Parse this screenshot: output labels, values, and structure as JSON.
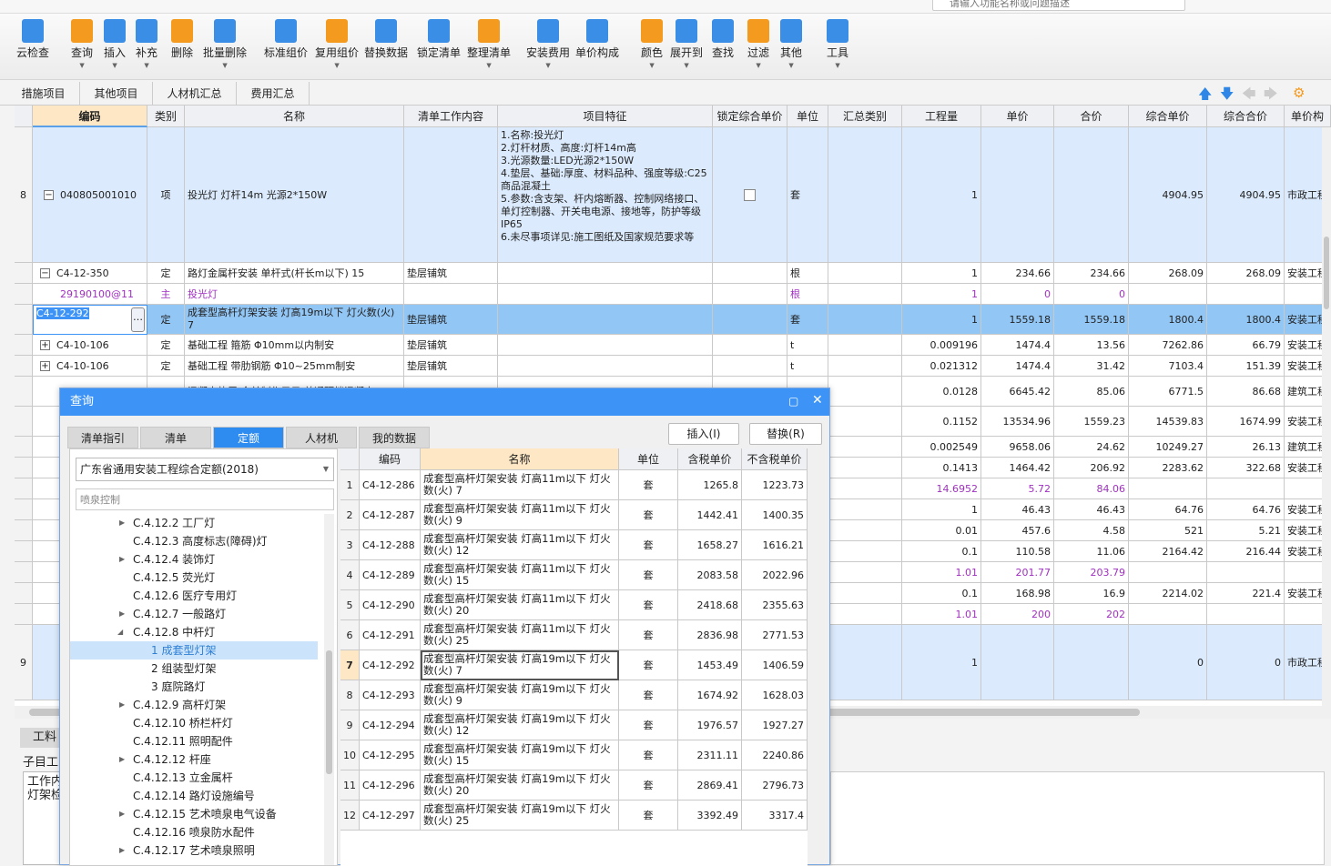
{
  "search_placeholder": "请输入功能名称或问题描述",
  "toolbar": [
    {
      "label": "云检查",
      "icon": "cloud-check-icon",
      "dd": false
    },
    {
      "label": "查询",
      "icon": "query-icon",
      "dd": true
    },
    {
      "label": "插入",
      "icon": "insert-icon",
      "dd": true
    },
    {
      "label": "补充",
      "icon": "supplement-icon",
      "dd": true
    },
    {
      "label": "删除",
      "icon": "delete-icon",
      "dd": false
    },
    {
      "label": "批量删除",
      "icon": "batch-delete-icon",
      "dd": true
    },
    {
      "label": "标准组价",
      "icon": "standard-pricing-icon",
      "dd": false
    },
    {
      "label": "复用组价",
      "icon": "reuse-pricing-icon",
      "dd": true
    },
    {
      "label": "替换数据",
      "icon": "replace-data-icon",
      "dd": false
    },
    {
      "label": "锁定清单",
      "icon": "lock-list-icon",
      "dd": false
    },
    {
      "label": "整理清单",
      "icon": "organize-list-icon",
      "dd": true
    },
    {
      "label": "安装费用",
      "icon": "install-cost-icon",
      "dd": true
    },
    {
      "label": "单价构成",
      "icon": "unit-price-icon",
      "dd": false
    },
    {
      "label": "颜色",
      "icon": "color-icon",
      "dd": true
    },
    {
      "label": "展开到",
      "icon": "expand-icon",
      "dd": true
    },
    {
      "label": "查找",
      "icon": "find-icon",
      "dd": false
    },
    {
      "label": "过滤",
      "icon": "filter-icon",
      "dd": true
    },
    {
      "label": "其他",
      "icon": "other-icon",
      "dd": true
    },
    {
      "label": "工具",
      "icon": "tools-icon",
      "dd": true
    }
  ],
  "page_tabs": [
    "措施项目",
    "其他项目",
    "人材机汇总",
    "费用汇总"
  ],
  "grid": {
    "columns": [
      "",
      "编码",
      "类别",
      "名称",
      "清单工作内容",
      "项目特征",
      "锁定综合单价",
      "单位",
      "汇总类别",
      "工程量",
      "单价",
      "合价",
      "综合单价",
      "综合合价",
      "单价构"
    ],
    "rows": [
      {
        "n": "8",
        "code": "040805001010",
        "type": "项",
        "name": "投光灯 灯杆14m 光源2*150W",
        "work": "",
        "feature": "1.名称:投光灯\n2.灯杆材质、高度:灯杆14m高\n3.光源数量:LED光源2*150W\n4.垫层、基础:厚度、材料品种、强度等级:C25商品混凝土\n5.参数:含支架、杆内熔断器、控制网络接口、单灯控制器、开关电电源、接地等，防护等级IP65\n6.未尽事项详见:施工图纸及国家规范要求等",
        "unit": "套",
        "qty": "1",
        "price": "",
        "total": "",
        "cprice": "4904.95",
        "ctotal": "4904.95",
        "comp": "市政工程"
      },
      {
        "n": "",
        "code": "C4-12-350",
        "type": "定",
        "name": "路灯金属杆安装 单杆式(杆长m以下) 15",
        "work": "垫层铺筑",
        "unit": "根",
        "qty": "1",
        "price": "234.66",
        "total": "234.66",
        "cprice": "268.09",
        "ctotal": "268.09",
        "comp": "安装工程"
      },
      {
        "n": "",
        "code": "29190100@11",
        "type": "主",
        "name": "投光灯",
        "work": "",
        "unit": "根",
        "qty": "1",
        "price": "0",
        "total": "0",
        "cprice": "",
        "ctotal": "",
        "comp": "",
        "purple": true
      },
      {
        "n": "",
        "code": "C4-12-292",
        "type": "定",
        "name": "成套型高杆灯架安装 灯高19m以下 灯火数(火) 7",
        "work": "垫层铺筑",
        "unit": "套",
        "qty": "1",
        "price": "1559.18",
        "total": "1559.18",
        "cprice": "1800.4",
        "ctotal": "1800.4",
        "comp": "安装工程",
        "sel": true
      },
      {
        "n": "",
        "code": "C4-10-106",
        "type": "定",
        "name": "基础工程 箍筋 Φ10mm以内制安",
        "work": "垫层铺筑",
        "unit": "t",
        "qty": "0.009196",
        "price": "1474.4",
        "total": "13.56",
        "cprice": "7262.86",
        "ctotal": "66.79",
        "comp": "安装工程"
      },
      {
        "n": "",
        "code": "C4-10-106",
        "type": "定",
        "name": "基础工程  带肋钢筋 Φ10~25mm制安",
        "work": "垫层铺筑",
        "unit": "t",
        "qty": "0.021312",
        "price": "1474.4",
        "total": "31.42",
        "cprice": "7103.4",
        "ctotal": "151.39",
        "comp": "安装工程"
      },
      {
        "n": "",
        "code": "",
        "type": "",
        "name": "混凝土垫层  含并制作子目 普通预拌混凝土",
        "work": "",
        "unit": "",
        "qty": "0.0128",
        "price": "6645.42",
        "total": "85.06",
        "cprice": "6771.5",
        "ctotal": "86.68",
        "comp": "建筑工程"
      },
      {
        "qty": "0.1152",
        "price": "13534.96",
        "total": "1559.23",
        "cprice": "14539.83",
        "ctotal": "1674.99",
        "comp": "安装工程"
      },
      {
        "qty": "0.002549",
        "price": "9658.06",
        "total": "24.62",
        "cprice": "10249.27",
        "ctotal": "26.13",
        "comp": "建筑工程"
      },
      {
        "qty": "0.1413",
        "price": "1464.42",
        "total": "206.92",
        "cprice": "2283.62",
        "ctotal": "322.68",
        "comp": "安装工程"
      },
      {
        "qty": "14.6952",
        "price": "5.72",
        "total": "84.06",
        "cprice": "",
        "ctotal": "",
        "comp": "",
        "purple": true
      },
      {
        "qty": "1",
        "price": "46.43",
        "total": "46.43",
        "cprice": "64.76",
        "ctotal": "64.76",
        "comp": "安装工程"
      },
      {
        "qty": "0.01",
        "price": "457.6",
        "total": "4.58",
        "cprice": "521",
        "ctotal": "5.21",
        "comp": "安装工程"
      },
      {
        "qty": "0.1",
        "price": "110.58",
        "total": "11.06",
        "cprice": "2164.42",
        "ctotal": "216.44",
        "comp": "安装工程"
      },
      {
        "qty": "1.01",
        "price": "201.77",
        "total": "203.79",
        "cprice": "",
        "ctotal": "",
        "comp": "",
        "purple": true
      },
      {
        "qty": "0.1",
        "price": "168.98",
        "total": "16.9",
        "cprice": "2214.02",
        "ctotal": "221.4",
        "comp": "安装工程"
      },
      {
        "qty": "1.01",
        "price": "200",
        "total": "202",
        "cprice": "",
        "ctotal": "",
        "comp": "",
        "purple": true
      },
      {
        "n": "9",
        "qty": "1",
        "price": "",
        "total": "",
        "cprice": "0",
        "ctotal": "0",
        "comp": "市政工程",
        "blue": true
      }
    ]
  },
  "bottom": {
    "tab": "工料",
    "label": "子目工",
    "text": "工作内\n灯架检"
  },
  "dialog": {
    "title": "查询",
    "tabs": [
      "清单指引",
      "清单",
      "定额",
      "人材机",
      "我的数据"
    ],
    "active_tab": "定额",
    "insert_label": "插入(I)",
    "replace_label": "替换(R)",
    "library": "广东省通用安装工程综合定额(2018)",
    "search_value": "喷泉控制",
    "tree": [
      {
        "t": "C.4.12.2 工厂灯",
        "lv": 1,
        "arrow": true
      },
      {
        "t": "C.4.12.3 高度标志(障碍)灯",
        "lv": 1
      },
      {
        "t": "C.4.12.4 装饰灯",
        "lv": 1,
        "arrow": true
      },
      {
        "t": "C.4.12.5 荧光灯",
        "lv": 1
      },
      {
        "t": "C.4.12.6 医疗专用灯",
        "lv": 1
      },
      {
        "t": "C.4.12.7 一般路灯",
        "lv": 1,
        "arrow": true
      },
      {
        "t": "C.4.12.8 中杆灯",
        "lv": 1,
        "arrow": true,
        "open": true
      },
      {
        "t": "1 成套型灯架",
        "lv": 2,
        "sel": true
      },
      {
        "t": "2 组装型灯架",
        "lv": 2
      },
      {
        "t": "3 庭院路灯",
        "lv": 2
      },
      {
        "t": "C.4.12.9 高杆灯架",
        "lv": 1,
        "arrow": true
      },
      {
        "t": "C.4.12.10 桥栏杆灯",
        "lv": 1
      },
      {
        "t": "C.4.12.11 照明配件",
        "lv": 1
      },
      {
        "t": "C.4.12.12 杆座",
        "lv": 1,
        "arrow": true
      },
      {
        "t": "C.4.12.13 立金属杆",
        "lv": 1
      },
      {
        "t": "C.4.12.14 路灯设施编号",
        "lv": 1
      },
      {
        "t": "C.4.12.15 艺术喷泉电气设备",
        "lv": 1,
        "arrow": true
      },
      {
        "t": "C.4.12.16 喷泉防水配件",
        "lv": 1
      },
      {
        "t": "C.4.12.17 艺术喷泉照明",
        "lv": 1,
        "arrow": true
      }
    ],
    "columns": [
      "",
      "编码",
      "名称",
      "单位",
      "含税单价",
      "不含税单价"
    ],
    "rows": [
      [
        "1",
        "C4-12-286",
        "成套型高杆灯架安装 灯高11m以下 灯火数(火) 7",
        "套",
        "1265.8",
        "1223.73"
      ],
      [
        "2",
        "C4-12-287",
        "成套型高杆灯架安装 灯高11m以下 灯火数(火) 9",
        "套",
        "1442.41",
        "1400.35"
      ],
      [
        "3",
        "C4-12-288",
        "成套型高杆灯架安装 灯高11m以下 灯火数(火) 12",
        "套",
        "1658.27",
        "1616.21"
      ],
      [
        "4",
        "C4-12-289",
        "成套型高杆灯架安装 灯高11m以下 灯火数(火) 15",
        "套",
        "2083.58",
        "2022.96"
      ],
      [
        "5",
        "C4-12-290",
        "成套型高杆灯架安装 灯高11m以下 灯火数(火) 20",
        "套",
        "2418.68",
        "2355.63"
      ],
      [
        "6",
        "C4-12-291",
        "成套型高杆灯架安装 灯高11m以下 灯火数(火) 25",
        "套",
        "2836.98",
        "2771.53"
      ],
      [
        "7",
        "C4-12-292",
        "成套型高杆灯架安装 灯高19m以下 灯火数(火) 7",
        "套",
        "1453.49",
        "1406.59"
      ],
      [
        "8",
        "C4-12-293",
        "成套型高杆灯架安装 灯高19m以下 灯火数(火) 9",
        "套",
        "1674.92",
        "1628.03"
      ],
      [
        "9",
        "C4-12-294",
        "成套型高杆灯架安装 灯高19m以下 灯火数(火) 12",
        "套",
        "1976.57",
        "1927.27"
      ],
      [
        "10",
        "C4-12-295",
        "成套型高杆灯架安装 灯高19m以下 灯火数(火) 15",
        "套",
        "2311.11",
        "2240.86"
      ],
      [
        "11",
        "C4-12-296",
        "成套型高杆灯架安装 灯高19m以下 灯火数(火) 20",
        "套",
        "2869.41",
        "2796.73"
      ],
      [
        "12",
        "C4-12-297",
        "成套型高杆灯架安装 灯高19m以下 灯火数(火) 25",
        "套",
        "3392.49",
        "3317.4"
      ]
    ],
    "selected_row": 6
  },
  "colors": {
    "accent": "#3d94f6",
    "selected_row": "#92c6f5",
    "header_highlight": "#fde7c4",
    "purple": "#a030c0"
  }
}
